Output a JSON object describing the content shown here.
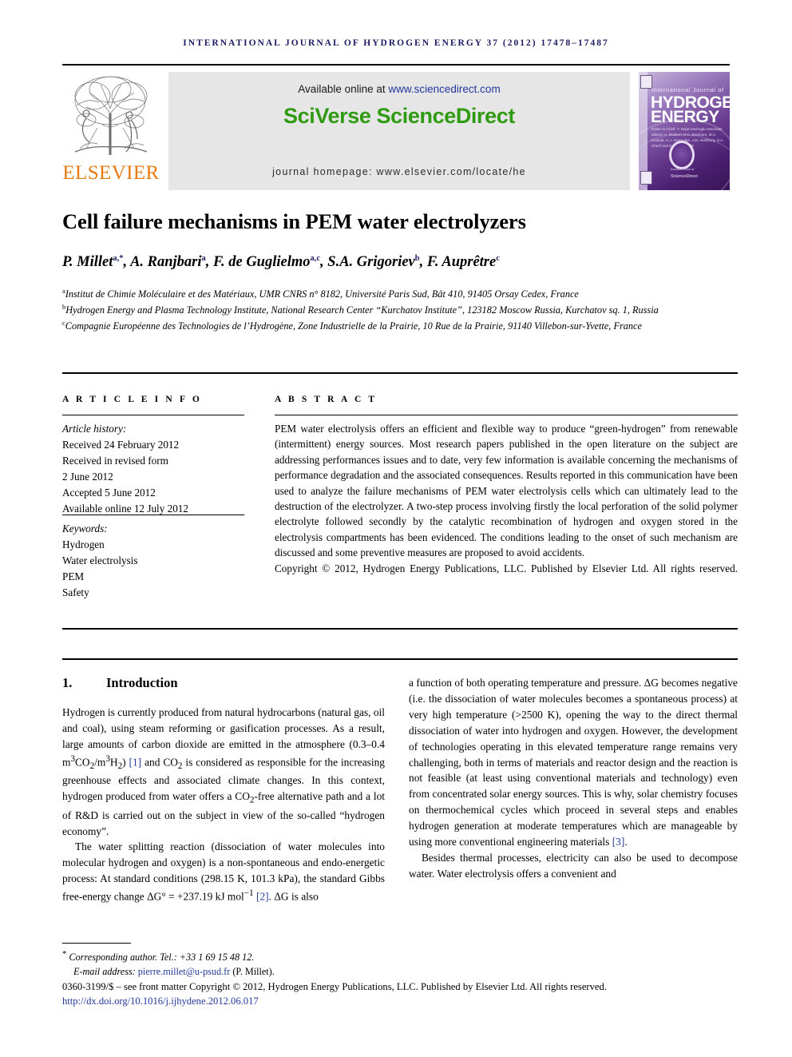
{
  "running_head": "INTERNATIONAL JOURNAL OF HYDROGEN ENERGY 37 (2012) 17478–17487",
  "masthead": {
    "publisher_name": "ELSEVIER",
    "available_prefix": "Available online at ",
    "available_url": "www.sciencedirect.com",
    "platform_logo": "SciVerse ScienceDirect",
    "homepage": "journal homepage: www.elsevier.com/locate/he",
    "cover": {
      "line_small": "International Journal of",
      "line_big_1": "HYDROGEN",
      "line_big_2": "ENERGY",
      "editors": "Editor-in-Chief: T. Nejat Veziroglu   Associate editors: A. Rustom, D.C. Branham, M.A. Kassab, H.J. morandan, J.M. Akellberg, S.A. Sherif and E.G. Verasadle",
      "provider": "ScienceDirect",
      "provider_top": "Available online at"
    }
  },
  "title": "Cell failure mechanisms in PEM water electrolyzers",
  "authors_html": "P. Millet<sup>a,*</sup>, A. Ranjbari<sup>a</sup>, F. de Guglielmo<sup>a,c</sup>, S.A. Grigoriev<sup>b</sup>, F. Auprêtre<sup>c</sup>",
  "affiliations": [
    "Institut de Chimie Moléculaire et des Matériaux, UMR CNRS n° 8182, Université Paris Sud, Bât 410, 91405 Orsay Cedex, France",
    "Hydrogen Energy and Plasma Technology Institute, National Research Center “Kurchatov Institute”, 123182 Moscow Russia, Kurchatov sq. 1, Russia",
    "Compagnie Européenne des Technologies de l’Hydrogène, Zone Industrielle de la Prairie, 10 Rue de la Prairie, 91140 Villebon-sur-Yvette, France"
  ],
  "affiliation_marks": [
    "a",
    "b",
    "c"
  ],
  "labels": {
    "article_info": "A R T I C L E   I N F O",
    "abstract": "A B S T R A C T"
  },
  "article_history": {
    "heading": "Article history:",
    "lines": [
      "Received 24 February 2012",
      "Received in revised form",
      "2 June 2012",
      "Accepted 5 June 2012",
      "Available online 12 July 2012"
    ]
  },
  "keywords": {
    "heading": "Keywords:",
    "items": [
      "Hydrogen",
      "Water electrolysis",
      "PEM",
      "Safety"
    ]
  },
  "abstract_text": "PEM water electrolysis offers an efficient and flexible way to produce “green-hydrogen” from renewable (intermittent) energy sources. Most research papers published in the open literature on the subject are addressing performances issues and to date, very few information is available concerning the mechanisms of performance degradation and the associated consequences. Results reported in this communication have been used to analyze the failure mechanisms of PEM water electrolysis cells which can ultimately lead to the destruction of the electrolyzer. A two-step process involving firstly the local perforation of the solid polymer electrolyte followed secondly by the catalytic recombination of hydrogen and oxygen stored in the electrolysis compartments has been evidenced. The conditions leading to the onset of such mechanism are discussed and some preventive measures are proposed to avoid accidents.",
  "abstract_copyright": "Copyright © 2012, Hydrogen Energy Publications, LLC. Published by Elsevier Ltd. All rights reserved.",
  "section": {
    "number": "1.",
    "title": "Introduction"
  },
  "body": {
    "left_p1_a": "Hydrogen is currently produced from natural hydrocarbons (natural gas, oil and coal), using steam reforming or gasification processes. As a result, large amounts of carbon dioxide are emitted in the atmosphere (0.3–0.4 m",
    "left_p1_b": " CO",
    "left_p1_c": "/m",
    "left_p1_d": " H",
    "left_p1_ref1": "[1]",
    "left_p1_e": " and CO",
    "left_p1_f": " is considered as responsible for the increasing greenhouse effects and associated climate changes. In this context, hydrogen produced from water offers a CO",
    "left_p1_g": "-free alternative path and a lot of R&D is carried out on the subject in view of the so-called “hydrogen economy”.",
    "left_p2_a": "The water splitting reaction (dissociation of water molecules into molecular hydrogen and oxygen) is a non-spontaneous and endo-energetic process: At standard conditions (298.15 K, 101.3 kPa), the standard Gibbs free-energy change ΔG° = +237.19 kJ mol",
    "left_p2_sup": "−1",
    "left_p2_ref2": "[2]",
    "left_p2_b": ". ΔG is also",
    "right_p1": "a function of both operating temperature and pressure. ΔG becomes negative (i.e. the dissociation of water molecules becomes a spontaneous process) at very high temperature (>2500 K), opening the way to the direct thermal dissociation of water into hydrogen and oxygen. However, the development of technologies operating in this elevated temperature range remains very challenging, both in terms of materials and reactor design and the reaction is not feasible (at least using conventional materials and technology) even from concentrated solar energy sources. This is why, solar chemistry focuses on thermochemical cycles which proceed in several steps and enables hydrogen generation at moderate temperatures which are manageable by using more conventional engineering materials ",
    "right_p1_ref3": "[3]",
    "right_p1_end": ".",
    "right_p2": "Besides thermal processes, electricity can also be used to decompose water. Water electrolysis offers a convenient and"
  },
  "footer": {
    "corresponding": "Corresponding author. Tel.: +33 1 69 15 48 12.",
    "email_label": "E-mail address: ",
    "email": "pierre.millet@u-psud.fr",
    "email_suffix": " (P. Millet).",
    "issn_line": "0360-3199/$ – see front matter Copyright © 2012, Hydrogen Energy Publications, LLC. Published by Elsevier Ltd. All rights reserved.",
    "doi": "http://dx.doi.org/10.1016/j.ijhydene.2012.06.017"
  },
  "colors": {
    "running_head": "#1b1b64",
    "link": "#23389c",
    "elsevier_orange": "#e87b10",
    "sciverse_green": "#2f9b12",
    "band_gray": "#e6e6e6"
  }
}
